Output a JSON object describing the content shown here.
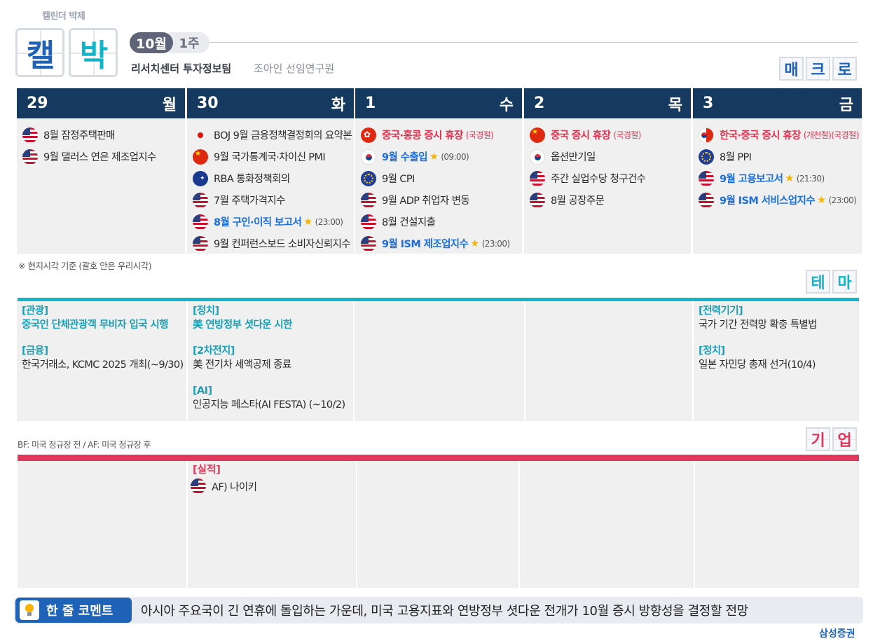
{
  "brand": {
    "small_label": "캘린더 박제",
    "logo_char_1": "캘",
    "logo_char_2": "박"
  },
  "header": {
    "month": "10월",
    "week": "1주",
    "team": "리서치센터 투자정보팀",
    "author": "조아인 선임연구원"
  },
  "sections": {
    "macro": [
      "매",
      "크",
      "로"
    ],
    "theme": [
      "테",
      "마"
    ],
    "corp": [
      "기",
      "업"
    ]
  },
  "days": [
    {
      "num": "29",
      "dow": "월",
      "events": [
        {
          "flag": "us",
          "text": "8월 잠정주택판매"
        },
        {
          "flag": "us",
          "text": "9월 댈러스 연은 제조업지수"
        }
      ]
    },
    {
      "num": "30",
      "dow": "화",
      "events": [
        {
          "flag": "jp",
          "text": "BOJ 9월 금융정책결정회의 요약본"
        },
        {
          "flag": "cn",
          "text": "9월 국가통계국·차이신 PMI"
        },
        {
          "flag": "au",
          "text": "RBA 통화정책회의"
        },
        {
          "flag": "us",
          "text": "7월 주택가격지수"
        },
        {
          "flag": "us",
          "text": "8월 구인·이직 보고서",
          "style": "blue",
          "star": "★",
          "time": "(23:00)"
        },
        {
          "flag": "us",
          "text": "9월 컨퍼런스보드 소비자신뢰지수"
        }
      ]
    },
    {
      "num": "1",
      "dow": "수",
      "events": [
        {
          "flag": "hk",
          "text": "중국·홍콩 증시 휴장",
          "style": "red",
          "note": "(국경절)"
        },
        {
          "flag": "kr",
          "text": "9월 수출입",
          "style": "blue",
          "star": "★",
          "time": "(09:00)"
        },
        {
          "flag": "eu",
          "text": "9월 CPI"
        },
        {
          "flag": "us",
          "text": "9월 ADP 취업자 변동"
        },
        {
          "flag": "us",
          "text": "8월 건설지출"
        },
        {
          "flag": "us",
          "text": "9월 ISM 제조업지수",
          "style": "blue",
          "star": "★",
          "time": "(23:00)"
        }
      ]
    },
    {
      "num": "2",
      "dow": "목",
      "events": [
        {
          "flag": "cn",
          "text": "중국 증시 휴장",
          "style": "red",
          "note": "(국경절)"
        },
        {
          "flag": "kr",
          "text": "옵션만기일"
        },
        {
          "flag": "us",
          "text": "주간 실업수당 청구건수"
        },
        {
          "flag": "us",
          "text": "8월 공장주문"
        }
      ]
    },
    {
      "num": "3",
      "dow": "금",
      "events": [
        {
          "flag": "krcn",
          "text": "한국·중국 증시 휴장",
          "style": "red",
          "note": "(개천절)(국경절)"
        },
        {
          "flag": "eu",
          "text": "8월 PPI"
        },
        {
          "flag": "us",
          "text": "9월 고용보고서",
          "style": "blue",
          "star": "★",
          "time": "(21:30)"
        },
        {
          "flag": "us",
          "text": "9월 ISM 서비스업지수",
          "style": "blue",
          "star": "★",
          "time": "(23:00)"
        }
      ]
    }
  ],
  "notes": {
    "time_note": "※ 현지시각 기준 (괄호 안은 우리시각)",
    "bf_af_note": "BF: 미국 정규장 전 / AF: 미국 정규장 후"
  },
  "themes": [
    {
      "items": [
        {
          "tag": "[관광]",
          "text": "중국인 단체관광객 무비자 입국 시행",
          "highlight": true
        },
        {
          "tag": "[금융]",
          "text": "한국거래소, KCMC 2025 개최(~9/30)",
          "highlight": false
        }
      ]
    },
    {
      "items": [
        {
          "tag": "[정치]",
          "text": "美 연방정부 셧다운 시한",
          "highlight": true
        },
        {
          "tag": "[2차전지]",
          "text": "美 전기차 세액공제 종료",
          "highlight": false
        },
        {
          "tag": "[AI]",
          "text": "인공지능 페스타(AI FESTA) (~10/2)",
          "highlight": false
        }
      ]
    },
    {
      "items": []
    },
    {
      "items": []
    },
    {
      "items": [
        {
          "tag": "[전력기기]",
          "text": "국가 기간 전력망 확충 특별법",
          "highlight": false
        },
        {
          "tag": "[정치]",
          "text": "일본 자민당 총재 선거(10/4)",
          "highlight": false
        }
      ]
    }
  ],
  "corp": [
    {
      "items": []
    },
    {
      "items": [
        {
          "tag": "[실적]",
          "flag": "us",
          "text": "AF) 나이키"
        }
      ]
    },
    {
      "items": []
    },
    {
      "items": []
    },
    {
      "items": []
    }
  ],
  "footer": {
    "comment_label": "한 줄 코멘트",
    "comment": "아시아 주요국이 긴 연휴에 돌입하는 가운데, 미국 고용지표와 연방정부 셧다운 전개가 10월 증시 방향성을 결정할 전망",
    "company": "삼성증권"
  },
  "colors": {
    "navy": "#163a5f",
    "theme_accent": "#12b4c8",
    "corp_accent": "#e2365b",
    "red_text": "#e0314f",
    "blue_text": "#1a6ee0",
    "logo_blue": "#1e63b8",
    "logo_teal": "#12b4c8"
  }
}
